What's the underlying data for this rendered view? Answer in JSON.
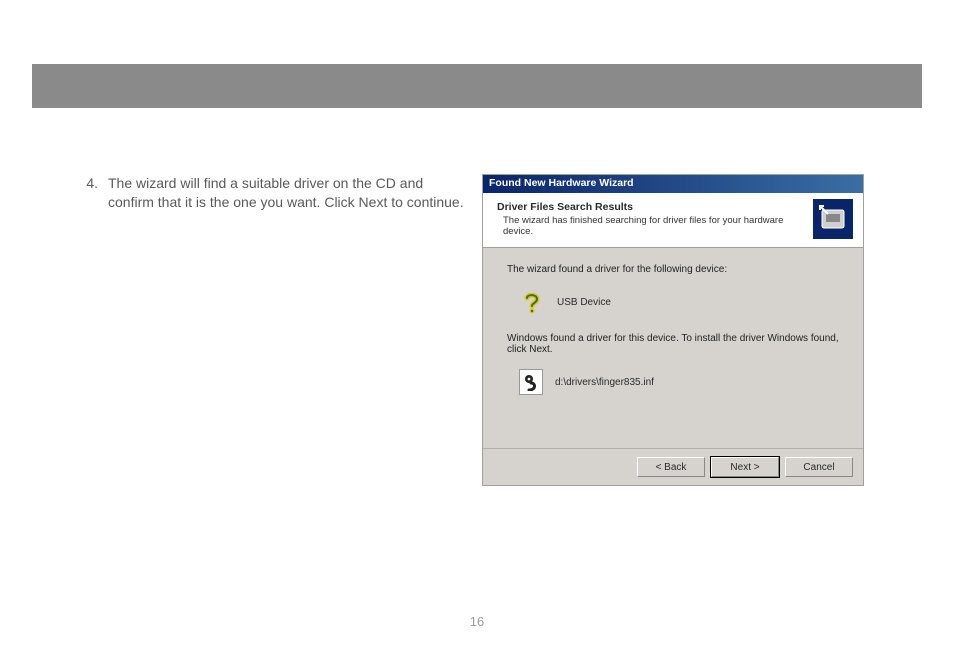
{
  "page_number": "16",
  "instruction": {
    "number": "4.",
    "text": "The wizard will find a suitable driver on the CD and confirm that it is the one you want.  Click Next to continue."
  },
  "dialog": {
    "title": "Found New Hardware Wizard",
    "header_title": "Driver Files Search Results",
    "header_sub": "The wizard has finished searching for driver files for your hardware device.",
    "body_line1": "The wizard found a driver for the following device:",
    "device_name": "USB Device",
    "body_line2": "Windows found a driver for this device. To install the driver Windows found, click Next.",
    "inf_path": "d:\\drivers\\finger835.inf",
    "buttons": {
      "back": "< Back",
      "next": "Next >",
      "cancel": "Cancel"
    }
  }
}
